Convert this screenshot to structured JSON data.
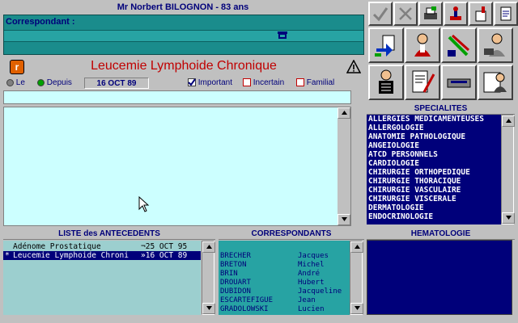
{
  "patient": {
    "header": "Mr Norbert BILOGNON - 83 ans"
  },
  "correspondant": {
    "label": "Correspondant :"
  },
  "diagnosis": {
    "title": "Leucemie Lymphoide Chronique",
    "logo_letter": "r"
  },
  "options": {
    "le_label": "Le",
    "depuis_label": "Depuis",
    "date": "16 OCT 89",
    "important_label": "Important",
    "incertain_label": "Incertain",
    "familial_label": "Familial"
  },
  "specialites": {
    "header": "SPECIALITES",
    "items": [
      "ALLERGIES MEDICAMENTEUSES",
      "ALLERGOLOGIE",
      "ANATOMIE PATHOLOGIQUE",
      "ANGEIOLOGIE",
      "ATCD PERSONNELS",
      "CARDIOLOGIE",
      "CHIRURGIE ORTHOPEDIQUE",
      "CHIRURGIE THORACIQUE",
      "CHIRURGIE VASCULAIRE",
      "CHIRURGIE VISCERALE",
      "DERMATOLOGIE",
      "ENDOCRINOLOGIE"
    ]
  },
  "antecedents": {
    "header": "LISTE des ANTECEDENTS",
    "rows": [
      {
        "mark": "",
        "name": "Adénome Prostatique",
        "date": "¬25 OCT 95",
        "selected": false
      },
      {
        "mark": "*",
        "name": "Leucemie Lymphoide Chroni",
        "date": "»16 OCT 89",
        "selected": true
      }
    ]
  },
  "correspondants": {
    "header": "CORRESPONDANTS",
    "rows": [
      {
        "last": "BRECHER",
        "first": "Jacques"
      },
      {
        "last": "BRETON",
        "first": "Michel"
      },
      {
        "last": "BRIN",
        "first": "André"
      },
      {
        "last": "DROUART",
        "first": "Hubert"
      },
      {
        "last": "DUBIDON",
        "first": "Jacqueline"
      },
      {
        "last": "ESCARTEFIGUE",
        "first": "Jean"
      },
      {
        "last": "GRADOLOWSKI",
        "first": "Lucien"
      }
    ]
  },
  "hematologie": {
    "header": "HEMATOLOGIE"
  },
  "colors": {
    "navy": "#00007a",
    "teal": "#1a8c8c",
    "light_cyan": "#ccffff",
    "title_red": "#c00000"
  },
  "toolbar_icons": [
    "check-icon",
    "cancel-icon",
    "print-icon",
    "stamp-icon",
    "delete-icon",
    "document-icon",
    "import-icon",
    "doctor-exam-icon",
    "pen-tools-icon",
    "telephone-doctor-icon",
    "xray-icon",
    "prescription-icon",
    "scanner-icon",
    "portrait-icon"
  ]
}
